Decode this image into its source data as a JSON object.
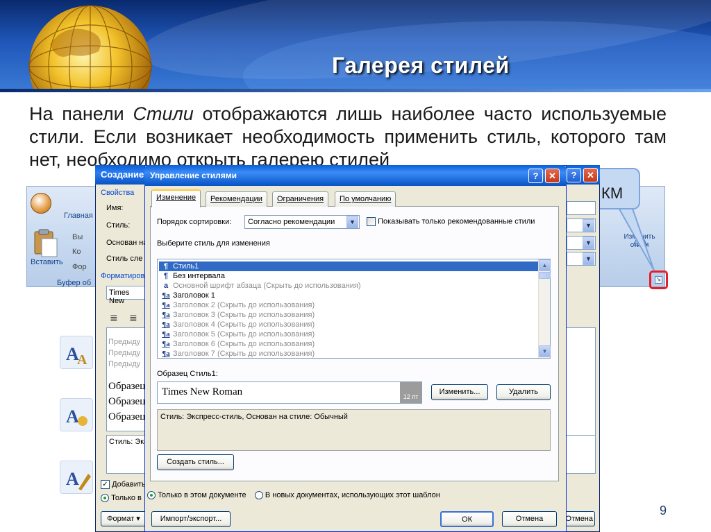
{
  "slide": {
    "title": "Галерея стилей",
    "body_parts": [
      "На панели ",
      "Стили",
      " отображаются лишь наиболее часто используемые стили. Если возникает необходимость применить стиль, которого там нет, необходимо открыть галерею стилей"
    ],
    "callout_text": "КМ",
    "page_number": "9",
    "colors": {
      "header": "#1f56b8",
      "title_text": "#ffffff",
      "highlight": "#e0202a",
      "callout": "#c6d9f3"
    }
  },
  "ribbon": {
    "tab_home": "Главная",
    "paste_label": "Вставить",
    "cut_label": "Вы",
    "copy_label": "Ко",
    "format_painter_label": "Фор",
    "clipboard_group": "Буфер об",
    "change_styles_label": "Изменить стили",
    "launcher_icon": "dialog-launcher-icon"
  },
  "create_style_dialog": {
    "title": "Создание",
    "section_properties": "Свойства",
    "name_label": "Имя:",
    "style_label": "Стиль:",
    "based_on_label": "Основан на",
    "next_style_label": "Стиль сле",
    "section_format": "Форматирова",
    "font_value": "Times New",
    "preview_prev1": "Предыду",
    "preview_prev2": "Предыду",
    "preview_prev3": "Предыду",
    "preview_sample1": "Образец",
    "preview_sample2": "Образец",
    "preview_sample3": "Образец",
    "description": "Стиль: Экс",
    "add_label": "Добавить",
    "only_doc_label": "Только в",
    "format_button": "Формат ▾",
    "cancel_button": "Отмена"
  },
  "manage_styles_dialog": {
    "title": "Управление стилями",
    "tabs": [
      "Изменение",
      "Рекомендации",
      "Ограничения",
      "По умолчанию"
    ],
    "active_tab": "Изменение",
    "sort_label": "Порядок сортировки:",
    "sort_value": "Согласно рекомендации",
    "show_recommended_label": "Показывать только рекомендованные стили",
    "select_label": "Выберите стиль для изменения",
    "styles": [
      {
        "glyph": "¶",
        "name": "Стиль1",
        "state": "selected"
      },
      {
        "glyph": "¶",
        "name": "Без интервала",
        "state": "normal"
      },
      {
        "glyph": "a",
        "name": "Основной шрифт абзаца  (Скрыть до использования)",
        "state": "hidden"
      },
      {
        "glyph": "¶a",
        "name": "Заголовок 1",
        "state": "normal"
      },
      {
        "glyph": "¶a",
        "name": "Заголовок 2  (Скрыть до использования)",
        "state": "hidden"
      },
      {
        "glyph": "¶a",
        "name": "Заголовок 3  (Скрыть до использования)",
        "state": "hidden"
      },
      {
        "glyph": "¶a",
        "name": "Заголовок 4  (Скрыть до использования)",
        "state": "hidden"
      },
      {
        "glyph": "¶a",
        "name": "Заголовок 5  (Скрыть до использования)",
        "state": "hidden"
      },
      {
        "glyph": "¶a",
        "name": "Заголовок 6  (Скрыть до использования)",
        "state": "hidden"
      },
      {
        "glyph": "¶a",
        "name": "Заголовок 7  (Скрыть до использования)",
        "state": "hidden"
      }
    ],
    "preview_label": "Образец Стиль1:",
    "preview_font": "Times New Roman",
    "preview_size": "12 пт",
    "modify_button": "Изменить...",
    "delete_button": "Удалить",
    "description": "Стиль: Экспресс-стиль, Основан на стиле: Обычный",
    "create_button": "Создать стиль...",
    "radio_this_doc": "Только в этом документе",
    "radio_new_docs": "В новых документах, использующих этот шаблон",
    "import_button": "Импорт/экспорт...",
    "ok_button": "ОК",
    "cancel_button": "Отмена"
  }
}
